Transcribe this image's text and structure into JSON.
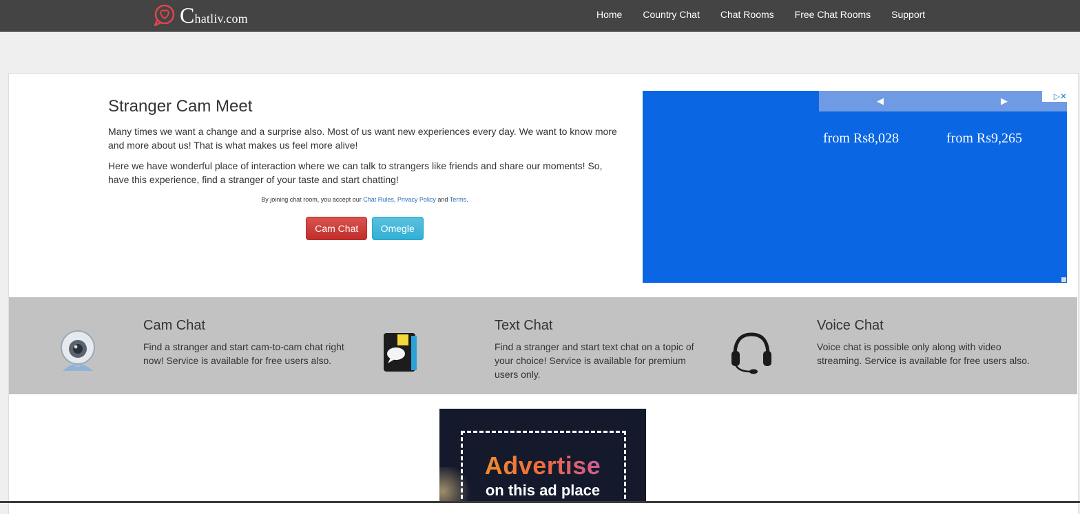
{
  "brand": {
    "logo_first": "C",
    "logo_rest": "hatliv.com"
  },
  "nav": {
    "items": [
      {
        "label": "Home"
      },
      {
        "label": "Country Chat"
      },
      {
        "label": "Chat Rooms"
      },
      {
        "label": "Free Chat Rooms"
      },
      {
        "label": "Support"
      }
    ]
  },
  "intro": {
    "title": "Stranger Cam Meet",
    "para1": "Many times we want a change and a surprise also. Most of us want new experiences every day. We want to know more and more about us! That is what makes us feel more alive!",
    "para2": "Here we have wonderful place of interaction where we can talk to strangers like friends and share our moments! So, have this experience, find a stranger of your taste and start chatting!",
    "terms_prefix": "By joining chat room, you accept our",
    "terms_link1": "Chat Rules",
    "terms_sep": ",",
    "terms_link2": "Privacy Policy",
    "terms_and": "and",
    "terms_link3": "Terms",
    "terms_end": ".",
    "btn_cam": "Cam Chat",
    "btn_omegle": "Omegle"
  },
  "ad": {
    "prev_arrow": "◀",
    "next_arrow": "▶",
    "close_label": "▷✕",
    "price1": "from Rs8,028",
    "price2": "from Rs9,265",
    "color": "#0b66e4"
  },
  "features": [
    {
      "icon": "webcam-icon",
      "title": "Cam Chat",
      "text": "Find a stranger and start cam-to-cam chat right now! Service is available for free users also."
    },
    {
      "icon": "chat-notes-icon",
      "title": "Text Chat",
      "text": "Find a stranger and start text chat on a topic of your choice! Service is available for premium users only."
    },
    {
      "icon": "headset-icon",
      "title": "Voice Chat",
      "text": "Voice chat is possible only along with video streaming. Service is available for free users also."
    }
  ],
  "bottom_ad": {
    "title": "Advertise",
    "subtitle": "on this ad place"
  },
  "colors": {
    "navbar": "#444444",
    "button_red": "#d9534f",
    "button_blue": "#5bc0de",
    "band": "#c2c2c2"
  }
}
